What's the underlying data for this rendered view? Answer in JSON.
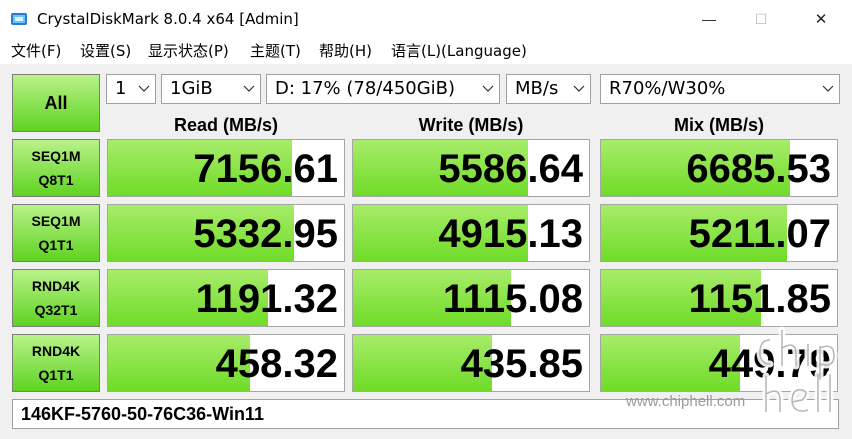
{
  "window": {
    "title": "CrystalDiskMark 8.0.4 x64 [Admin]",
    "minimize_glyph": "—",
    "maximize_glyph": "☐",
    "close_glyph": "✕"
  },
  "menu": [
    {
      "label": "文件(F)"
    },
    {
      "label": "设置(S)"
    },
    {
      "label": "显示状态(P)"
    },
    {
      "label": "主题(T)"
    },
    {
      "label": "帮助(H)"
    },
    {
      "label": "语言(L)(Language)"
    }
  ],
  "controls": {
    "all_button": "All",
    "count": "1",
    "size": "1GiB",
    "drive": "D: 17% (78/450GiB)",
    "unit": "MB/s",
    "mix": "R70%/W30%"
  },
  "columns": {
    "read": "Read (MB/s)",
    "write": "Write (MB/s)",
    "mix": "Mix (MB/s)"
  },
  "rows": [
    {
      "line1": "SEQ1M",
      "line2": "Q8T1",
      "read": "7156.61",
      "write": "5586.64",
      "mix": "6685.53",
      "read_fill": 0.78,
      "write_fill": 0.74,
      "mix_fill": 0.8
    },
    {
      "line1": "SEQ1M",
      "line2": "Q1T1",
      "read": "5332.95",
      "write": "4915.13",
      "mix": "5211.07",
      "read_fill": 0.79,
      "write_fill": 0.74,
      "mix_fill": 0.79
    },
    {
      "line1": "RND4K",
      "line2": "Q32T1",
      "read": "1191.32",
      "write": "1115.08",
      "mix": "1151.85",
      "read_fill": 0.68,
      "write_fill": 0.67,
      "mix_fill": 0.68
    },
    {
      "line1": "RND4K",
      "line2": "Q1T1",
      "read": "458.32",
      "write": "435.85",
      "mix": "449.79",
      "read_fill": 0.6,
      "write_fill": 0.59,
      "mix_fill": 0.59
    }
  ],
  "comment": "146KF-5760-50-76C36-Win11",
  "watermark": "www.chiphell.com",
  "colors": {
    "accent_green": "#5fd321",
    "light_green": "#b9f28a"
  }
}
